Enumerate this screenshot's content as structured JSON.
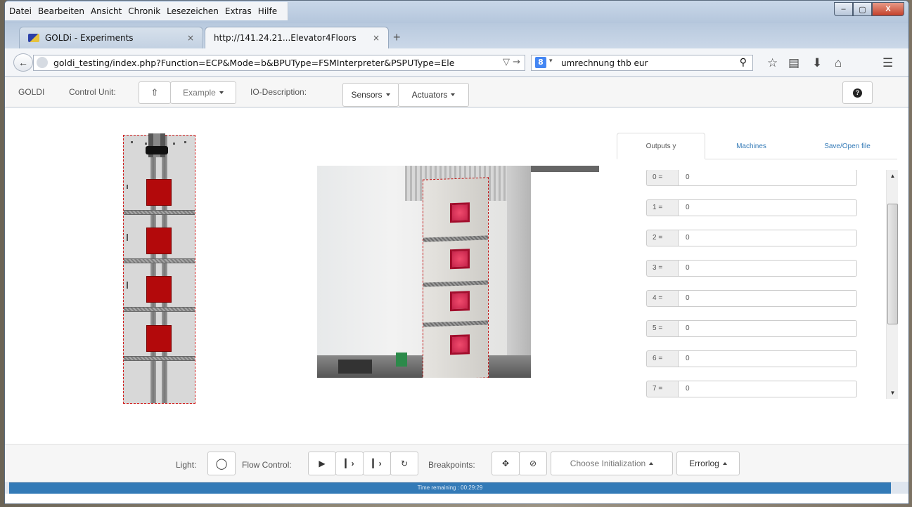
{
  "menu": [
    "Datei",
    "Bearbeiten",
    "Ansicht",
    "Chronik",
    "Lesezeichen",
    "Extras",
    "Hilfe"
  ],
  "window_controls": {
    "minimize": "–",
    "maximize": "▢",
    "close": "X"
  },
  "tabs": [
    {
      "title": "GOLDi - Experiments",
      "close": "×"
    },
    {
      "title": "http://141.24.21...Elevator4Floors",
      "close": "×"
    }
  ],
  "new_tab": "+",
  "address_bar": {
    "url": "goldi_testing/index.php?Function=ECP&Mode=b&BPUType=FSMInterpreter&PSPUType=Ele",
    "dropdown": "▽ →"
  },
  "search_bar": {
    "engine": "8",
    "engine_dropdown": "▾",
    "query": "umrechnung thb eur"
  },
  "toolbar_icons": [
    "search-icon",
    "star-icon",
    "reading-list-icon",
    "download-icon",
    "home-icon",
    "menu-icon"
  ],
  "appbar": {
    "brand": "GOLDI",
    "control_unit_label": "Control Unit:",
    "example_label": "Example",
    "io_description_label": "IO-Description:",
    "sensors_label": "Sensors",
    "actuators_label": "Actuators",
    "help_icon": "?"
  },
  "panel": {
    "tabs": [
      {
        "label": "Outputs y",
        "active": true
      },
      {
        "label": "Machines",
        "active": false
      },
      {
        "label": "Save/Open file",
        "active": false
      }
    ],
    "outputs": [
      {
        "index": "0 =",
        "value": "0"
      },
      {
        "index": "1 =",
        "value": "0"
      },
      {
        "index": "2 =",
        "value": "0"
      },
      {
        "index": "3 =",
        "value": "0"
      },
      {
        "index": "4 =",
        "value": "0"
      },
      {
        "index": "5 =",
        "value": "0"
      },
      {
        "index": "6 =",
        "value": "0"
      },
      {
        "index": "7 =",
        "value": "0"
      }
    ]
  },
  "bottombar": {
    "light_label": "Light:",
    "flow_control_label": "Flow Control:",
    "breakpoints_label": "Breakpoints:",
    "choose_init_label": "Choose Initialization",
    "errorlog_label": "Errorlog"
  },
  "progress": {
    "text": "Time remaining : 00:29:29",
    "fraction": 1.0
  },
  "colors": {
    "accent": "#337ab7",
    "cab": "#b3090b",
    "link": "#337ab7"
  }
}
